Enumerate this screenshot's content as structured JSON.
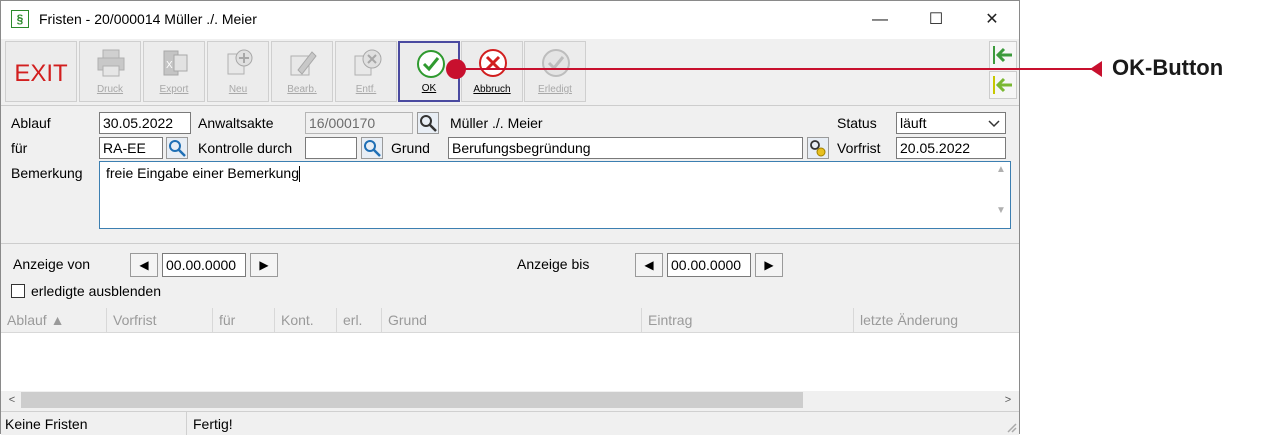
{
  "window": {
    "title": "Fristen - 20/000014 Müller ./. Meier",
    "app_icon": "§"
  },
  "window_controls": {
    "minimize": "—",
    "maximize": "☐",
    "close": "✕"
  },
  "toolbar": {
    "exit": "EXIT",
    "druck": "Druck",
    "export": "Export",
    "neu": "Neu",
    "bearb": "Bearb.",
    "entf": "Entf.",
    "ok": "OK",
    "abbruch": "Abbruch",
    "erledigt": "Erledigt"
  },
  "form": {
    "ablauf_label": "Ablauf",
    "ablauf_value": "30.05.2022",
    "anwaltsakte_label": "Anwaltsakte",
    "anwaltsakte_value": "16/000170",
    "parties": "Müller ./. Meier",
    "status_label": "Status",
    "status_value": "läuft",
    "fuer_label": "für",
    "fuer_value": "RA-EE",
    "kontrolle_label": "Kontrolle durch",
    "kontrolle_value": "",
    "grund_label": "Grund",
    "grund_value": "Berufungsbegründung",
    "vorfrist_label": "Vorfrist",
    "vorfrist_value": "20.05.2022",
    "bemerkung_label": "Bemerkung",
    "bemerkung_value": "freie Eingabe einer Bemerkung"
  },
  "filter": {
    "anzeige_von_label": "Anzeige von",
    "anzeige_von_value": "00.00.0000",
    "anzeige_bis_label": "Anzeige bis",
    "anzeige_bis_value": "00.00.0000",
    "erledigte_label": "erledigte ausblenden",
    "arrow_left": "◀",
    "arrow_right": "▶"
  },
  "table": {
    "columns": [
      "Ablauf ▲",
      "Vorfrist",
      "für",
      "Kont.",
      "erl.",
      "Grund",
      "Eintrag",
      "letzte Änderung"
    ]
  },
  "scroll": {
    "left": "<",
    "right": ">"
  },
  "statusbar": {
    "left": "Keine Fristen",
    "right": "Fertig!"
  },
  "callout": {
    "label": "OK-Button",
    "color": "#c8102e"
  }
}
